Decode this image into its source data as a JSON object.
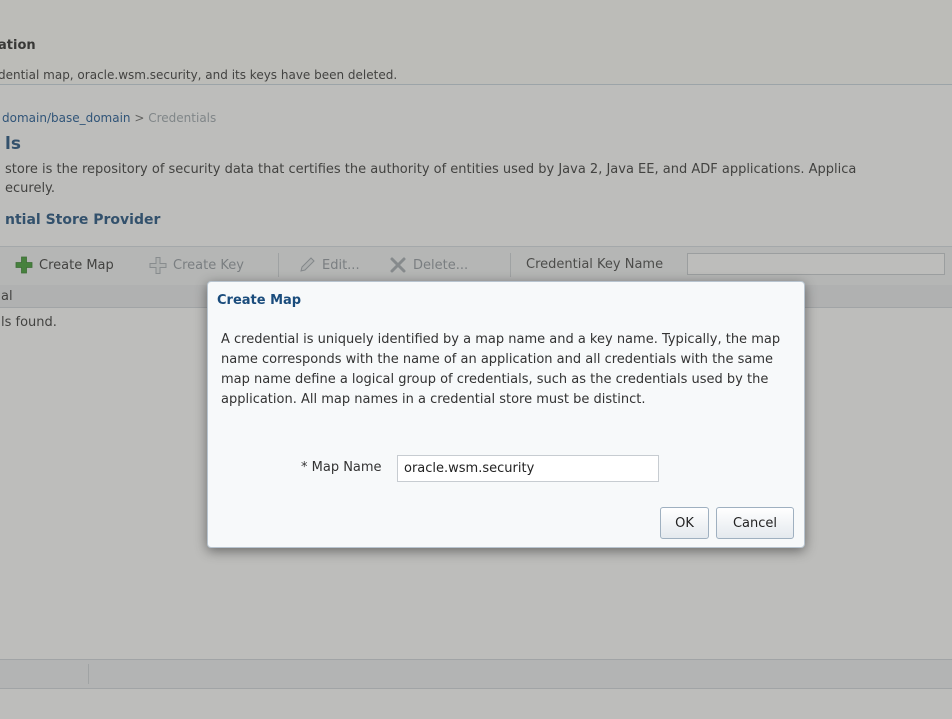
{
  "banner": {
    "title": "ation",
    "message": "dential map, oracle.wsm.security, and its keys have been deleted."
  },
  "breadcrumb": {
    "link": "domain/base_domain",
    "separator": ">",
    "current": "Credentials"
  },
  "page": {
    "title": "ls",
    "description_line1": "store is the repository of security data that certifies the authority of entities used by Java 2, Java EE, and ADF applications. Applica",
    "description_line2": "ecurely.",
    "section_title": "ntial Store Provider"
  },
  "toolbar": {
    "create_map": "Create Map",
    "create_key": "Create Key",
    "edit": "Edit...",
    "delete": "Delete...",
    "search_label": "Credential Key Name",
    "search_value": ""
  },
  "table": {
    "column": "al",
    "empty_text": "ls found."
  },
  "dialog": {
    "title": "Create Map",
    "description": "A credential is uniquely identified by a map name and a key name. Typically, the map name corresponds with the name of an application and all credentials with the same map name define a logical group of credentials, such as the credentials used by the application. All map names in a credential store must be distinct.",
    "field_label": "* Map Name",
    "field_value": "oracle.wsm.security",
    "ok_label": "OK",
    "cancel_label": "Cancel"
  },
  "icons": {
    "create_map": "plus-icon",
    "create_key": "plus-icon",
    "edit": "pencil-icon",
    "delete": "delete-x-icon"
  },
  "colors": {
    "heading": "#1a4c7c",
    "link": "#14508f",
    "plus_green": "#3a9b2e"
  }
}
